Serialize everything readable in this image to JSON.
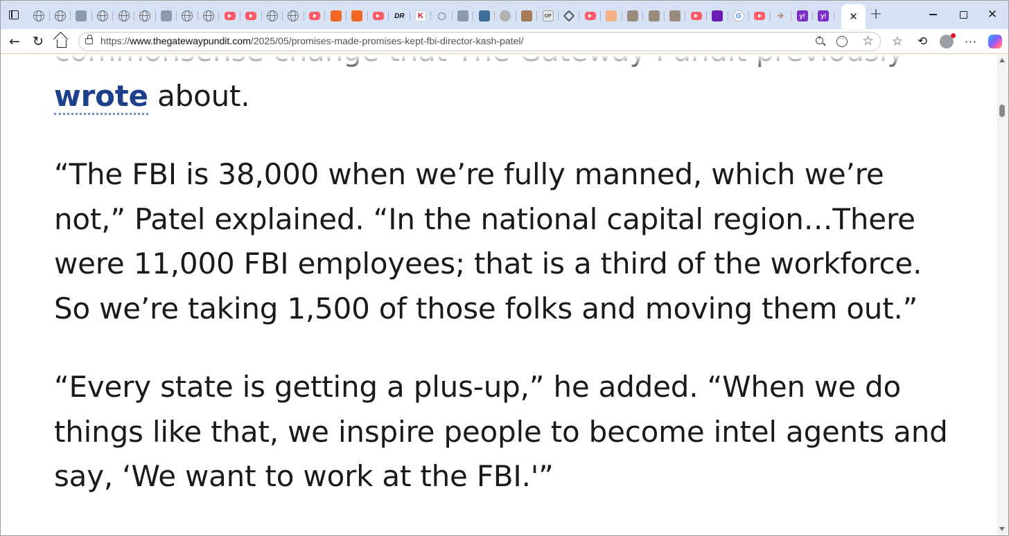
{
  "tabs": [
    {
      "icon": "globe-icon",
      "style": "globe"
    },
    {
      "icon": "globe-icon",
      "style": "globe"
    },
    {
      "icon": "news-icon",
      "style": "grey"
    },
    {
      "icon": "globe-icon",
      "style": "globe"
    },
    {
      "icon": "globe-icon",
      "style": "globe"
    },
    {
      "icon": "globe-icon",
      "style": "globe"
    },
    {
      "icon": "pdf-icon",
      "style": "grey"
    },
    {
      "icon": "globe-icon",
      "style": "globe"
    },
    {
      "icon": "globe-icon",
      "style": "globe"
    },
    {
      "icon": "youtube-icon",
      "style": "yt"
    },
    {
      "icon": "youtube-icon",
      "style": "yt"
    },
    {
      "icon": "globe-icon",
      "style": "globe"
    },
    {
      "icon": "globe-icon",
      "style": "globe"
    },
    {
      "icon": "youtube-icon",
      "style": "yt"
    },
    {
      "icon": "bookmark-icon",
      "style": "orange"
    },
    {
      "icon": "bookmark-icon",
      "style": "orange"
    },
    {
      "icon": "youtube-icon",
      "style": "yt"
    },
    {
      "icon": "dr-logo-icon",
      "style": "dark",
      "text": "DR"
    },
    {
      "icon": "k-logo-icon",
      "style": "red",
      "text": "K"
    },
    {
      "icon": "search-icon",
      "style": "search"
    },
    {
      "icon": "mm-logo-icon",
      "style": "grey"
    },
    {
      "icon": "f-logo-icon",
      "style": "blue"
    },
    {
      "icon": "badge-icon",
      "style": "badge"
    },
    {
      "icon": "photo-icon",
      "style": "brown"
    },
    {
      "icon": "gp-logo-icon",
      "style": "gp",
      "text": "GP"
    },
    {
      "icon": "diamond-icon",
      "style": "diamond"
    },
    {
      "icon": "youtube-icon",
      "style": "yt"
    },
    {
      "icon": "b-logo-icon",
      "style": "peach"
    },
    {
      "icon": "photo-icon",
      "style": "photo"
    },
    {
      "icon": "photo-icon",
      "style": "photo"
    },
    {
      "icon": "photo-icon",
      "style": "photo"
    },
    {
      "icon": "youtube-icon",
      "style": "yt"
    },
    {
      "icon": "mail-icon",
      "style": "purple"
    },
    {
      "icon": "google-icon",
      "style": "google",
      "text": "G"
    },
    {
      "icon": "youtube-icon",
      "style": "yt"
    },
    {
      "icon": "bird-icon",
      "style": "bird",
      "text": "✈"
    },
    {
      "icon": "yahoo-icon",
      "style": "yahoo",
      "text": "y!"
    },
    {
      "icon": "yahoo-icon",
      "style": "yahoo",
      "text": "y!"
    }
  ],
  "active_tab": {
    "close_glyph": "✕"
  },
  "new_tab_glyph": "+",
  "window_controls": {
    "close_glyph": "✕"
  },
  "toolbar": {
    "back_glyph": "←",
    "reload_glyph": "↻",
    "favorites_glyph": "☆",
    "history_glyph": "⟲",
    "more_glyph": "···"
  },
  "address": {
    "scheme": "https://",
    "host": "www.thegatewaypundit.com",
    "path": "/2025/05/promises-made-promises-kept-fbi-director-kash-patel/",
    "star_glyph": "☆",
    "reader_glyph": "···"
  },
  "article": {
    "p1_text": "commonsense change that The Gateway Pundit previously ",
    "p1_link": "wrote",
    "p1_tail": " about.",
    "p2": "“The FBI is 38,000 when we’re fully manned, which we’re not,” Patel explained. “In the national capital region…There were 11,000 FBI employees; that is a third of the workforce. So we’re taking 1,500 of those folks and moving them out.”",
    "p3": "“Every state is getting a plus-up,” he added. “When we do things like that, we inspire people to become intel agents and say, ‘We want to work at the FBI.'”"
  },
  "colors": {
    "tabstrip_bg": "#d6e2f4",
    "link": "#1e3f8a",
    "text": "#1a1a1a"
  }
}
